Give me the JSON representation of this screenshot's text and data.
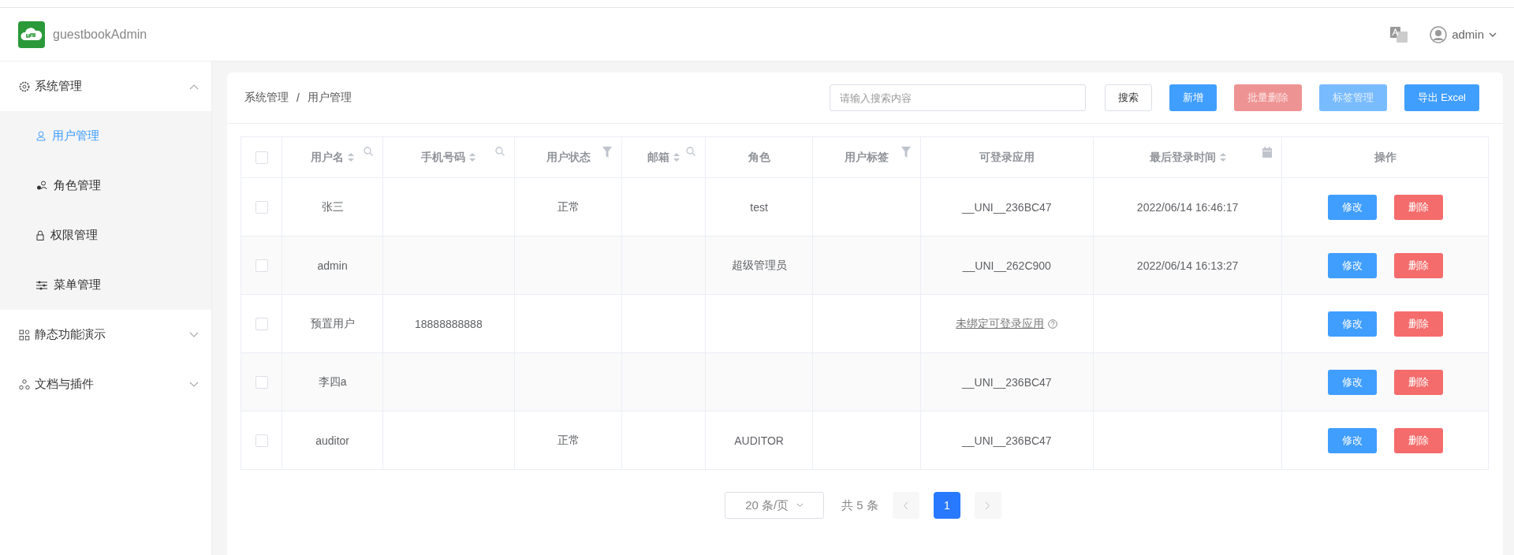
{
  "app": {
    "title": "guestbookAdmin",
    "user": "admin"
  },
  "sidebar": {
    "groups": [
      {
        "label": "系统管理",
        "expanded": true,
        "children": [
          {
            "label": "用户管理",
            "selected": true
          },
          {
            "label": "角色管理",
            "selected": false
          },
          {
            "label": "权限管理",
            "selected": false
          },
          {
            "label": "菜单管理",
            "selected": false
          }
        ]
      },
      {
        "label": "静态功能演示",
        "expanded": false
      },
      {
        "label": "文档与插件",
        "expanded": false
      }
    ]
  },
  "breadcrumb": {
    "items": [
      "系统管理",
      "用户管理"
    ],
    "separator": "/"
  },
  "search": {
    "placeholder": "请输入搜索内容"
  },
  "buttons": [
    {
      "label": "搜索",
      "kind": "default",
      "disabled": false
    },
    {
      "label": "新增",
      "kind": "primary",
      "disabled": false
    },
    {
      "label": "批量删除",
      "kind": "danger",
      "disabled": true
    },
    {
      "label": "标签管理",
      "kind": "primary",
      "disabled": true
    },
    {
      "label": "导出 Excel",
      "kind": "primary",
      "disabled": false
    }
  ],
  "table": {
    "select_all": {
      "checked": false
    },
    "columns": [
      {
        "label": "用户名",
        "sortable": true,
        "searchable": true,
        "filterable": false,
        "date_filter": false
      },
      {
        "label": "手机号码",
        "sortable": true,
        "searchable": true,
        "filterable": false,
        "date_filter": false
      },
      {
        "label": "用户状态",
        "sortable": false,
        "searchable": false,
        "filterable": true,
        "date_filter": false
      },
      {
        "label": "邮箱",
        "sortable": true,
        "searchable": true,
        "filterable": false,
        "date_filter": false
      },
      {
        "label": "角色",
        "sortable": false,
        "searchable": false,
        "filterable": false,
        "date_filter": false
      },
      {
        "label": "用户标签",
        "sortable": false,
        "searchable": false,
        "filterable": true,
        "date_filter": false
      },
      {
        "label": "可登录应用",
        "sortable": false,
        "searchable": false,
        "filterable": false,
        "date_filter": false
      },
      {
        "label": "最后登录时间",
        "sortable": true,
        "searchable": false,
        "filterable": false,
        "date_filter": true
      },
      {
        "label": "操作",
        "sortable": false,
        "searchable": false,
        "filterable": false,
        "date_filter": false
      }
    ],
    "rows": [
      {
        "checked": false,
        "username": "张三",
        "status": "正常",
        "role": "test",
        "app": {
          "kind": "text",
          "text": "__UNI__236BC47"
        },
        "last_login": "2022/06/14 16:46:17",
        "actions": [
          "修改",
          "删除"
        ]
      },
      {
        "checked": false,
        "username": "admin",
        "role": "超级管理员",
        "app": {
          "kind": "text",
          "text": "__UNI__262C900"
        },
        "last_login": "2022/06/14 16:13:27",
        "actions": [
          "修改",
          "删除"
        ]
      },
      {
        "checked": false,
        "username": "预置用户",
        "phone": "18888888888",
        "app": {
          "kind": "link",
          "text": "未绑定可登录应用"
        },
        "actions": [
          "修改",
          "删除"
        ]
      },
      {
        "checked": false,
        "username": "李四a",
        "app": {
          "kind": "text",
          "text": "__UNI__236BC47"
        },
        "actions": [
          "修改",
          "删除"
        ]
      },
      {
        "checked": false,
        "username": "auditor",
        "status": "正常",
        "role": "AUDITOR",
        "app": {
          "kind": "text",
          "text": "__UNI__236BC47"
        },
        "actions": [
          "修改",
          "删除"
        ]
      }
    ]
  },
  "pagination": {
    "page_size": "20 条/页",
    "total": "共 5 条",
    "pages": [
      {
        "label": "1",
        "selected": true
      }
    ]
  }
}
